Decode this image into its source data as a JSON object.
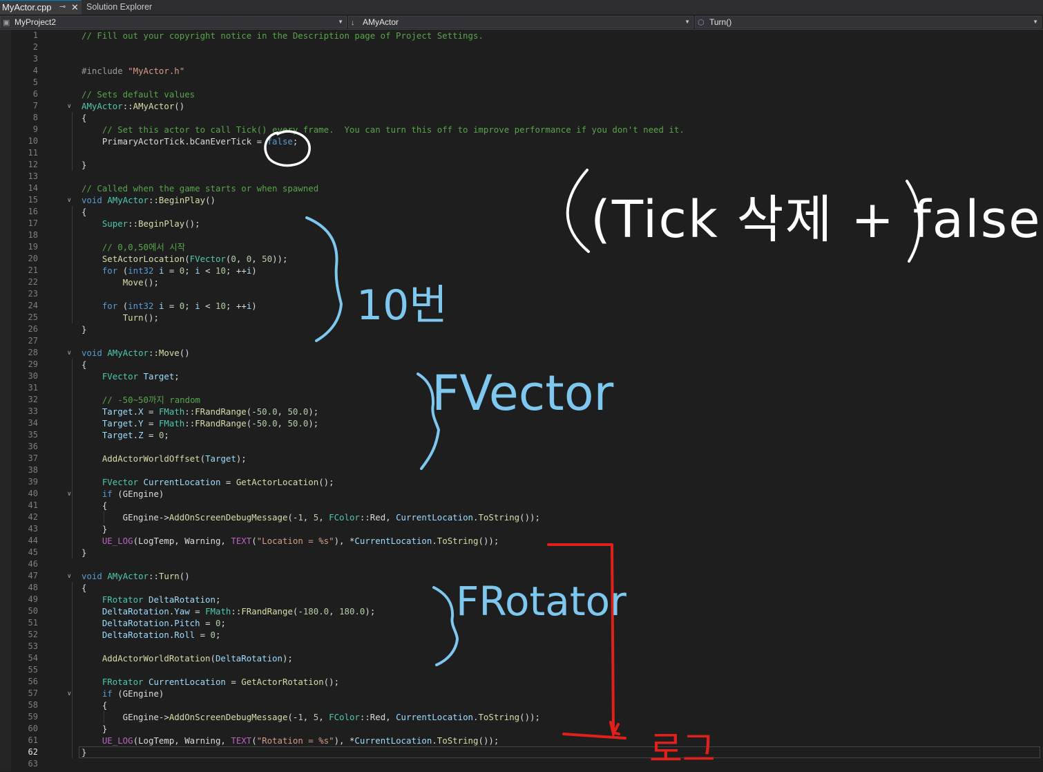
{
  "tabs": {
    "active": {
      "label": "MyActor.cpp",
      "pin_icon": "pin-icon",
      "close_icon": "close-icon"
    },
    "inactive": {
      "label": "Solution Explorer"
    }
  },
  "nav": {
    "project": "MyProject2",
    "class": "AMyActor",
    "member": "Turn()"
  },
  "editor": {
    "current_line": 62,
    "lines": [
      {
        "n": "1",
        "code": "<span class='c'>// Fill out your copyright notice in the Description page of Project Settings.</span>"
      },
      {
        "n": "2",
        "code": ""
      },
      {
        "n": "3",
        "code": ""
      },
      {
        "n": "4",
        "code": "<span class='p'>#include</span> <span class='s'>\"MyActor.h\"</span>"
      },
      {
        "n": "5",
        "code": ""
      },
      {
        "n": "6",
        "code": "<span class='c'>// Sets default values</span>"
      },
      {
        "n": "7",
        "fold": true,
        "code": "<span class='t'>AMyActor</span>::<span class='f'>AMyActor</span>()"
      },
      {
        "n": "8",
        "code": "{"
      },
      {
        "n": "9",
        "code": "    <span class='c'>// Set this actor to call Tick() every frame.  You can turn this off to improve performance if you don't need it.</span>"
      },
      {
        "n": "10",
        "code": "    PrimaryActorTick.bCanEverTick = <span class='k'>false</span>;"
      },
      {
        "n": "11",
        "code": ""
      },
      {
        "n": "12",
        "code": "}"
      },
      {
        "n": "13",
        "code": ""
      },
      {
        "n": "14",
        "code": "<span class='c'>// Called when the game starts or when spawned</span>"
      },
      {
        "n": "15",
        "fold": true,
        "code": "<span class='k'>void</span> <span class='t'>AMyActor</span>::<span class='f'>BeginPlay</span>()"
      },
      {
        "n": "16",
        "code": "{"
      },
      {
        "n": "17",
        "code": "    <span class='t'>Super</span>::<span class='f'>BeginPlay</span>();"
      },
      {
        "n": "18",
        "code": ""
      },
      {
        "n": "19",
        "code": "    <span class='c'>// 0,0,50에서 시작</span>"
      },
      {
        "n": "20",
        "code": "    <span class='f'>SetActorLocation</span>(<span class='t'>FVector</span>(<span class='n'>0</span>, <span class='n'>0</span>, <span class='n'>50</span>));"
      },
      {
        "n": "21",
        "code": "    <span class='k'>for</span> (<span class='k'>int32</span> <span class='v'>i</span> = <span class='n'>0</span>; <span class='v'>i</span> &lt; <span class='n'>10</span>; ++<span class='v'>i</span>)"
      },
      {
        "n": "22",
        "code": "        <span class='f'>Move</span>();"
      },
      {
        "n": "23",
        "code": ""
      },
      {
        "n": "24",
        "code": "    <span class='k'>for</span> (<span class='k'>int32</span> <span class='v'>i</span> = <span class='n'>0</span>; <span class='v'>i</span> &lt; <span class='n'>10</span>; ++<span class='v'>i</span>)"
      },
      {
        "n": "25",
        "code": "        <span class='f'>Turn</span>();"
      },
      {
        "n": "26",
        "code": "}"
      },
      {
        "n": "27",
        "code": ""
      },
      {
        "n": "28",
        "fold": true,
        "code": "<span class='k'>void</span> <span class='t'>AMyActor</span>::<span class='f'>Move</span>()"
      },
      {
        "n": "29",
        "code": "{"
      },
      {
        "n": "30",
        "code": "    <span class='t'>FVector</span> <span class='v'>Target</span>;"
      },
      {
        "n": "31",
        "code": ""
      },
      {
        "n": "32",
        "code": "    <span class='c'>// -50~50까지 random</span>"
      },
      {
        "n": "33",
        "code": "    <span class='v'>Target</span>.<span class='v'>X</span> = <span class='t'>FMath</span>::<span class='f'>FRandRange</span>(-<span class='n'>50.0</span>, <span class='n'>50.0</span>);"
      },
      {
        "n": "34",
        "code": "    <span class='v'>Target</span>.<span class='v'>Y</span> = <span class='t'>FMath</span>::<span class='f'>FRandRange</span>(-<span class='n'>50.0</span>, <span class='n'>50.0</span>);"
      },
      {
        "n": "35",
        "code": "    <span class='v'>Target</span>.<span class='v'>Z</span> = <span class='n'>0</span>;"
      },
      {
        "n": "36",
        "code": ""
      },
      {
        "n": "37",
        "code": "    <span class='f'>AddActorWorldOffset</span>(<span class='v'>Target</span>);"
      },
      {
        "n": "38",
        "code": ""
      },
      {
        "n": "39",
        "code": "    <span class='t'>FVector</span> <span class='v'>CurrentLocation</span> = <span class='f'>GetActorLocation</span>();"
      },
      {
        "n": "40",
        "fold": true,
        "code": "    <span class='k'>if</span> (GEngine)"
      },
      {
        "n": "41",
        "code": "    {"
      },
      {
        "n": "42",
        "code": "        GEngine-&gt;<span class='f'>AddOnScreenDebugMessage</span>(-<span class='n'>1</span>, <span class='n'>5</span>, <span class='t'>FColor</span>::Red, <span class='v'>CurrentLocation</span>.<span class='f'>ToString</span>());"
      },
      {
        "n": "43",
        "code": "    }"
      },
      {
        "n": "44",
        "code": "    <span class='mc'>UE_LOG</span>(LogTemp, Warning, <span class='mc'>TEXT</span>(<span class='s'>\"Location = %s\"</span>), *<span class='v'>CurrentLocation</span>.<span class='f'>ToString</span>());"
      },
      {
        "n": "45",
        "code": "}"
      },
      {
        "n": "46",
        "code": ""
      },
      {
        "n": "47",
        "fold": true,
        "code": "<span class='k'>void</span> <span class='t'>AMyActor</span>::<span class='f'>Turn</span>()"
      },
      {
        "n": "48",
        "code": "{"
      },
      {
        "n": "49",
        "code": "    <span class='t'>FRotator</span> <span class='v'>DeltaRotation</span>;"
      },
      {
        "n": "50",
        "code": "    <span class='v'>DeltaRotation</span>.<span class='v'>Yaw</span> = <span class='t'>FMath</span>::<span class='f'>FRandRange</span>(-<span class='n'>180.0</span>, <span class='n'>180.0</span>);"
      },
      {
        "n": "51",
        "code": "    <span class='v'>DeltaRotation</span>.<span class='v'>Pitch</span> = <span class='n'>0</span>;"
      },
      {
        "n": "52",
        "code": "    <span class='v'>DeltaRotation</span>.<span class='v'>Roll</span> = <span class='n'>0</span>;"
      },
      {
        "n": "53",
        "code": ""
      },
      {
        "n": "54",
        "code": "    <span class='f'>AddActorWorldRotation</span>(<span class='v'>DeltaRotation</span>);"
      },
      {
        "n": "55",
        "code": ""
      },
      {
        "n": "56",
        "code": "    <span class='t'>FRotator</span> <span class='v'>CurrentLocation</span> = <span class='f'>GetActorRotation</span>();"
      },
      {
        "n": "57",
        "fold": true,
        "code": "    <span class='k'>if</span> (GEngine)"
      },
      {
        "n": "58",
        "code": "    {"
      },
      {
        "n": "59",
        "code": "        GEngine-&gt;<span class='f'>AddOnScreenDebugMessage</span>(-<span class='n'>1</span>, <span class='n'>5</span>, <span class='t'>FColor</span>::Red, <span class='v'>CurrentLocation</span>.<span class='f'>ToString</span>());"
      },
      {
        "n": "60",
        "code": "    }"
      },
      {
        "n": "61",
        "code": "    <span class='mc'>UE_LOG</span>(LogTemp, Warning, <span class='mc'>TEXT</span>(<span class='s'>\"Rotation = %s\"</span>), *<span class='v'>CurrentLocation</span>.<span class='f'>ToString</span>());"
      },
      {
        "n": "62",
        "code": "}"
      },
      {
        "n": "63",
        "code": ""
      }
    ]
  },
  "annotations": {
    "tick": "(Tick 삭제 + false)",
    "count": "10번",
    "fvector": "FVector",
    "frotator": "FRotator",
    "log": "로그",
    "colors": {
      "white": "#ffffff",
      "blue": "#7ec8f0",
      "red": "#e0201a"
    }
  }
}
